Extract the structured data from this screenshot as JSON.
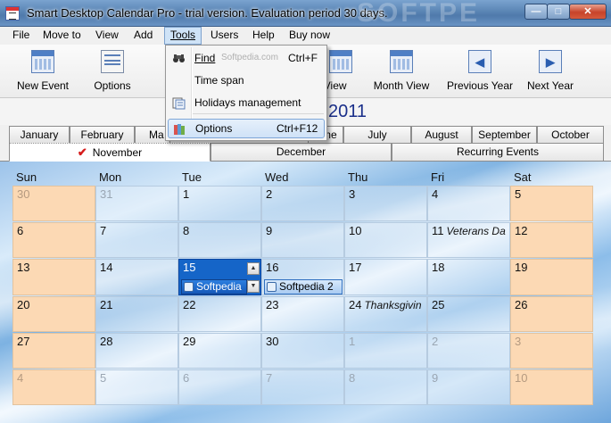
{
  "window": {
    "title": "Smart Desktop Calendar Pro - trial version. Evaluation period 30 days.",
    "watermark": "SOFTPE",
    "min_glyph": "—",
    "max_glyph": "□",
    "close_glyph": "✕"
  },
  "menubar": {
    "file": "File",
    "move_to": "Move to",
    "view": "View",
    "add": "Add",
    "tools": "Tools",
    "users": "Users",
    "help": "Help",
    "buy_now": "Buy now"
  },
  "toolbar": {
    "new_event": "New Event",
    "options": "Options",
    "week_view": "k View",
    "month_view": "Month View",
    "previous_year": "Previous Year",
    "next_year": "Next Year",
    "prev_arrow": "◀",
    "next_arrow": "▶"
  },
  "year": "2011",
  "months_row1": [
    "January",
    "February",
    "Ma",
    "me",
    "July",
    "August",
    "September",
    "October"
  ],
  "months_row2": {
    "november": "November",
    "december": "December",
    "recurring": "Recurring Events",
    "check": "✔"
  },
  "weekdays": [
    "Sun",
    "Mon",
    "Tue",
    "Wed",
    "Thu",
    "Fri",
    "Sat"
  ],
  "weeks": [
    [
      "30",
      "31",
      "1",
      "2",
      "3",
      "4",
      "5"
    ],
    [
      "6",
      "7",
      "8",
      "9",
      "10",
      "11",
      "12"
    ],
    [
      "13",
      "14",
      "15",
      "16",
      "17",
      "18",
      "19"
    ],
    [
      "20",
      "21",
      "22",
      "23",
      "24",
      "25",
      "26"
    ],
    [
      "27",
      "28",
      "29",
      "30",
      "1",
      "2",
      "3"
    ],
    [
      "4",
      "5",
      "6",
      "7",
      "8",
      "9",
      "10"
    ]
  ],
  "holidays": {
    "veterans": "Veterans Da",
    "thanksgiving": "Thanksgivin"
  },
  "events": {
    "e15": "Softpedia",
    "e16": "Softpedia 2"
  },
  "cell_scroll": {
    "up": "▲",
    "down": "▼"
  },
  "tools_menu": {
    "find": "Find",
    "find_key": "Ctrl+F",
    "find_hint": "Softpedia.com",
    "time_span": "Time span",
    "holidays": "Holidays management",
    "options": "Options",
    "options_key": "Ctrl+F12"
  }
}
